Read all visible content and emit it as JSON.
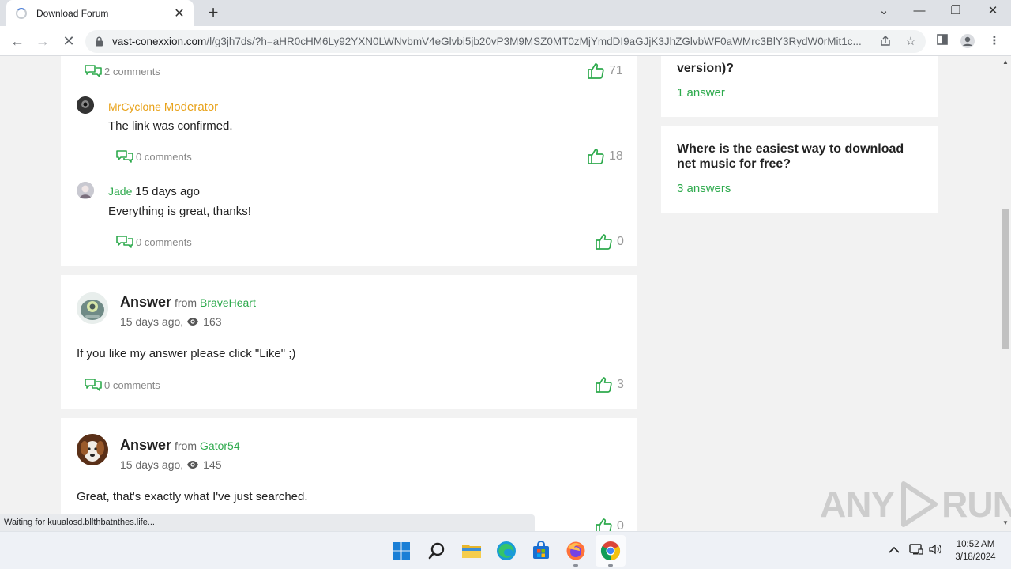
{
  "browser": {
    "tab_title": "Download Forum",
    "url_domain": "vast-conexxion.com",
    "url_path": "/l/g3jh7ds/?h=aHR0cHM6Ly92YXN0LWNvbmV4eGlvbi5jb20vP3M9MSZ0MT0zMjYmdDI9aGJjK3JhZGlvbWF0aWMrc3BlY3RydW0rMit1c...",
    "status_text": "Waiting for kuualosd.bllthbatnthes.life..."
  },
  "thread": {
    "top_comments": "2 comments",
    "top_likes": "71",
    "replies": [
      {
        "user": "MrCyclone",
        "role": "Moderator",
        "time": "",
        "text": "The link was confirmed.",
        "comments": "0 comments",
        "likes": "18"
      },
      {
        "user": "Jade",
        "role": "",
        "time": "15 days ago",
        "text": "Everything is great, thanks!",
        "comments": "0 comments",
        "likes": "0"
      }
    ],
    "answers": [
      {
        "label": "Answer",
        "from": "from",
        "user": "BraveHeart",
        "time": "15 days ago,",
        "views": "163",
        "text": "If you like my answer please click \"Like\" ;)",
        "comments": "0 comments",
        "likes": "3"
      },
      {
        "label": "Answer",
        "from": "from",
        "user": "Gator54",
        "time": "15 days ago,",
        "views": "145",
        "text": "Great, that's exactly what I've just searched.",
        "likes": "0"
      }
    ]
  },
  "sidebar": {
    "questions": [
      {
        "title_tail": "version)?",
        "answers": "1 answer"
      },
      {
        "title": "Where is the easiest way to download net music for free?",
        "answers": "3 answers"
      }
    ]
  },
  "watermark": "ANY RUN",
  "taskbar": {
    "time": "10:52 AM",
    "date": "3/18/2024"
  },
  "colors": {
    "accent_green": "#2eaa4d",
    "moderator_orange": "#e8a21a",
    "chrome_bar": "#dee1e6"
  }
}
